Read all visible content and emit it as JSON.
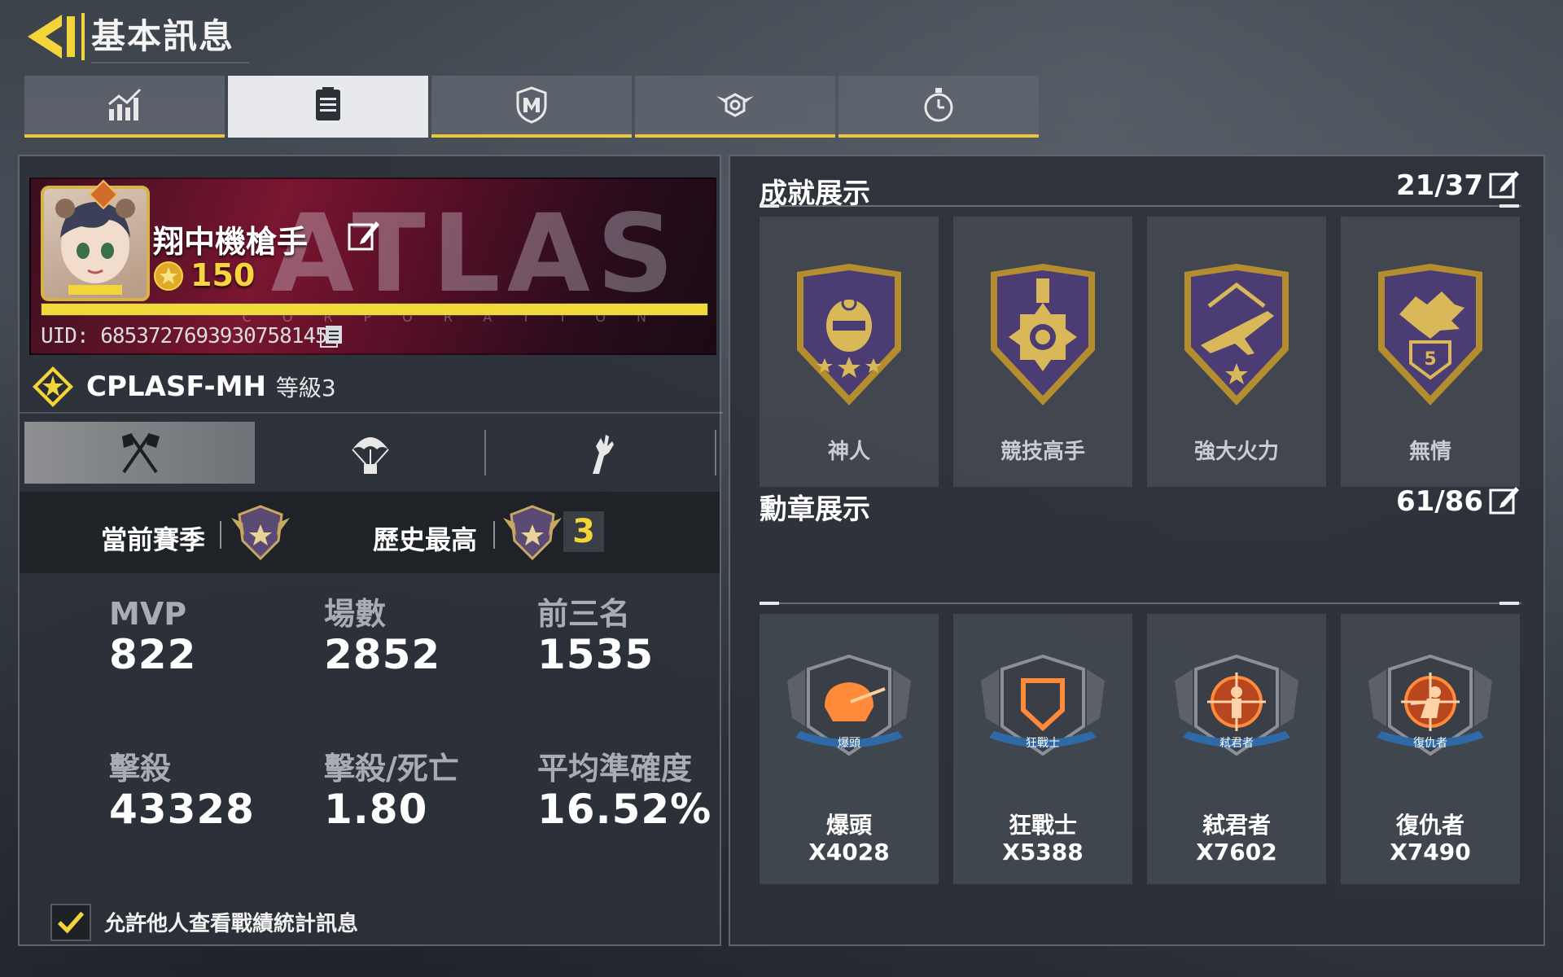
{
  "header": {
    "title": "基本訊息"
  },
  "tabs": [
    {
      "icon": "stats-chart-icon",
      "active": false
    },
    {
      "icon": "clipboard-icon",
      "active": true
    },
    {
      "icon": "shield-icon",
      "active": false
    },
    {
      "icon": "winged-emblem-icon",
      "active": false
    },
    {
      "icon": "stopwatch-icon",
      "active": false
    }
  ],
  "profile": {
    "name": "翔中機槍手",
    "coins": "150",
    "xp_fraction": 1.0,
    "uid": "UID: 6853727693930758145",
    "banner_watermark": "ATLAS",
    "banner_watermark_sub": "CORPORATION"
  },
  "clan": {
    "name": "CPLASF-MH",
    "level": "等級3"
  },
  "season": {
    "current_label": "當前賽季",
    "best_label": "歷史最高",
    "best_rank": "3"
  },
  "stats": {
    "mvp": {
      "label": "MVP",
      "value": "822"
    },
    "matches": {
      "label": "場數",
      "value": "2852"
    },
    "top3": {
      "label": "前三名",
      "value": "1535"
    },
    "kills": {
      "label": "擊殺",
      "value": "43328"
    },
    "kd": {
      "label": "擊殺/死亡",
      "value": "1.80"
    },
    "accuracy": {
      "label": "平均準確度",
      "value": "16.52%"
    }
  },
  "privacy": {
    "label": "允許他人查看戰績統計訊息",
    "checked": true
  },
  "achievements": {
    "title": "成就展示",
    "count": "21/37",
    "items": [
      {
        "label": "神人",
        "icon": "masked-soldier-badge-icon"
      },
      {
        "label": "競技高手",
        "icon": "cross-medal-badge-icon"
      },
      {
        "label": "強大火力",
        "icon": "jet-badge-icon"
      },
      {
        "label": "無情",
        "icon": "wolf-badge-icon"
      }
    ]
  },
  "medals": {
    "title": "勳章展示",
    "count": "61/86",
    "items": [
      {
        "label": "爆頭",
        "ribbon": "爆頭",
        "count": "X4028",
        "icon": "headshot-medal-icon"
      },
      {
        "label": "狂戰士",
        "ribbon": "狂戰士",
        "count": "X5388",
        "icon": "berserker-medal-icon"
      },
      {
        "label": "弒君者",
        "ribbon": "弒君者",
        "count": "X7602",
        "icon": "kingslayer-medal-icon"
      },
      {
        "label": "復仇者",
        "ribbon": "復仇者",
        "count": "X7490",
        "icon": "avenger-medal-icon"
      }
    ]
  },
  "colors": {
    "accent": "#f2d43b",
    "panel": "#2c3139",
    "card": "#444a52"
  }
}
